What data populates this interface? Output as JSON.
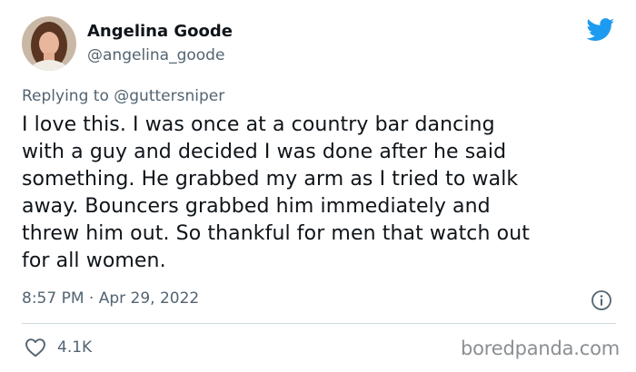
{
  "author": {
    "name": "Angelina Goode",
    "handle": "@angelina_goode",
    "avatar_icon": "profile-photo"
  },
  "reply": {
    "prefix": "Replying to ",
    "mention": "@guttersniper"
  },
  "tweet": {
    "lines": [
      "I love this. I was once at a country bar dancing",
      "with a guy and decided I was done after he said",
      "something. He grabbed my arm as I tried to walk",
      "away. Bouncers grabbed him immediately and",
      "threw him out. So thankful for men that watch out",
      "for all women."
    ],
    "timestamp": "8:57 PM · Apr 29, 2022"
  },
  "engagement": {
    "like_icon": "heart-icon",
    "likes": "4.1K"
  },
  "icons": {
    "platform": "twitter-bird-icon",
    "info": "info-icon"
  },
  "watermark": "boredpanda.com",
  "colors": {
    "brand": "#1d9bf0",
    "text": "#0f1419",
    "secondary": "#536471",
    "divider": "#cfd9de"
  }
}
